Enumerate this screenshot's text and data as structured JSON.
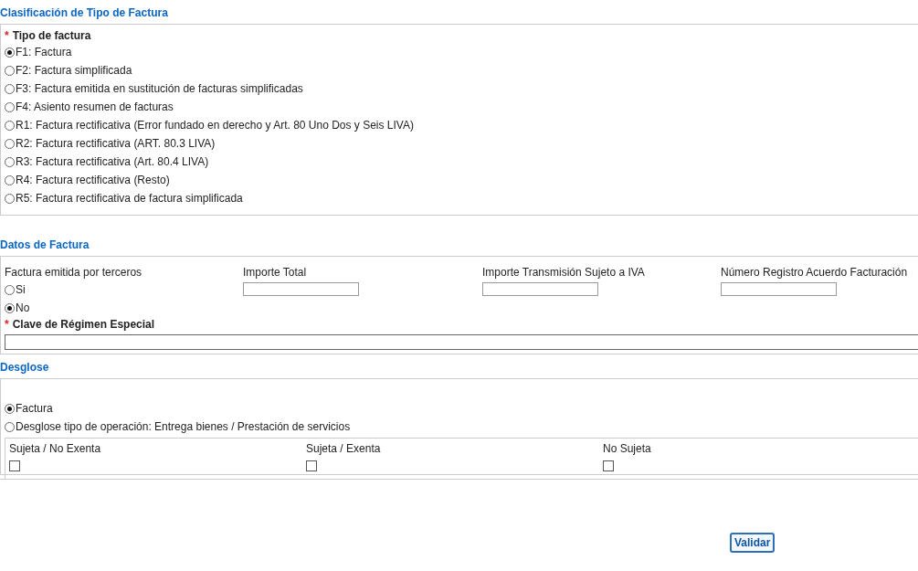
{
  "clasificacion": {
    "title": "Clasificación de Tipo de Factura",
    "field": {
      "required_mark": "*",
      "label": "Tipo de factura"
    },
    "options": [
      {
        "label": "F1: Factura",
        "selected": true
      },
      {
        "label": "F2: Factura simplificada",
        "selected": false
      },
      {
        "label": "F3: Factura emitida en sustitución de facturas simplificadas",
        "selected": false
      },
      {
        "label": "F4: Asiento resumen de facturas",
        "selected": false
      },
      {
        "label": "R1: Factura rectificativa (Error fundado en derecho y Art. 80 Uno Dos y Seis LIVA)",
        "selected": false
      },
      {
        "label": "R2: Factura rectificativa (ART. 80.3 LIVA)",
        "selected": false
      },
      {
        "label": "R3: Factura rectificativa (Art. 80.4 LIVA)",
        "selected": false
      },
      {
        "label": "R4: Factura rectificativa (Resto)",
        "selected": false
      },
      {
        "label": "R5: Factura rectificativa de factura simplificada",
        "selected": false
      }
    ]
  },
  "datos": {
    "title": "Datos de Factura",
    "terceros": {
      "label": "Factura emitida por terceros",
      "options": [
        {
          "label": "Si",
          "selected": false
        },
        {
          "label": "No",
          "selected": true
        }
      ]
    },
    "inputs": [
      {
        "label": "Importe Total"
      },
      {
        "label": "Importe Transmisión Sujeto a IVA"
      },
      {
        "label": "Número Registro Acuerdo Facturación"
      }
    ],
    "clave": {
      "required_mark": "*",
      "label": "Clave de Régimen Especial"
    }
  },
  "desglose": {
    "title": "Desglose",
    "options": [
      {
        "label": "Factura",
        "selected": true
      },
      {
        "label": "Desglose tipo de operación: Entrega bienes / Prestación de servicios",
        "selected": false
      }
    ],
    "checks": [
      {
        "label": "Sujeta / No Exenta",
        "checked": false
      },
      {
        "label": "Sujeta / Exenta",
        "checked": false
      },
      {
        "label": "No Sujeta",
        "checked": false
      }
    ]
  },
  "button": "Validar"
}
